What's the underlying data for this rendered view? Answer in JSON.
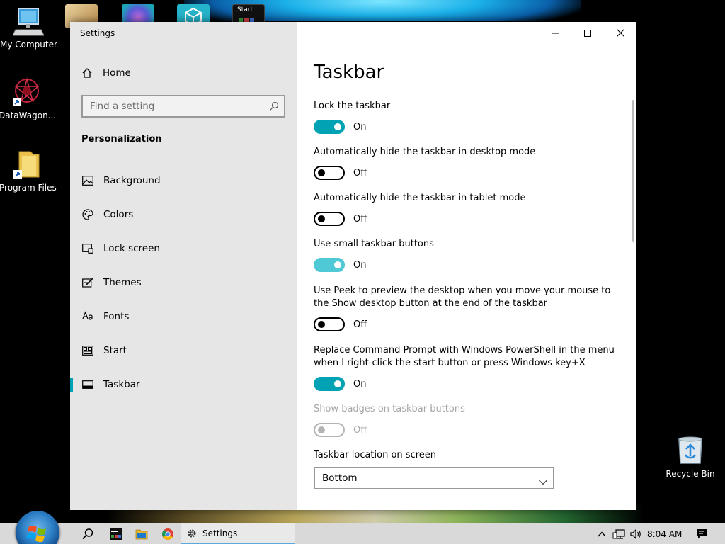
{
  "desktop": {
    "icons": [
      {
        "label": "My Computer"
      },
      {
        "label": "DataWagon..."
      },
      {
        "label": "Program Files"
      },
      {
        "label": "Recycle Bin"
      }
    ],
    "top_tile_label": "Start"
  },
  "window": {
    "title": "Settings",
    "controls": {
      "minimize": "minimize",
      "maximize": "maximize",
      "close": "close"
    }
  },
  "sidebar": {
    "home_label": "Home",
    "search": {
      "placeholder": "Find a setting",
      "value": ""
    },
    "section_title": "Personalization",
    "items": [
      {
        "label": "Background",
        "icon": "image-icon"
      },
      {
        "label": "Colors",
        "icon": "palette-icon"
      },
      {
        "label": "Lock screen",
        "icon": "lock-screen-icon"
      },
      {
        "label": "Themes",
        "icon": "themes-icon"
      },
      {
        "label": "Fonts",
        "icon": "fonts-icon"
      },
      {
        "label": "Start",
        "icon": "start-icon"
      },
      {
        "label": "Taskbar",
        "icon": "taskbar-icon",
        "active": true
      }
    ]
  },
  "main": {
    "title": "Taskbar",
    "settings": [
      {
        "label": "Lock the taskbar",
        "state": "On"
      },
      {
        "label": "Automatically hide the taskbar in desktop mode",
        "state": "Off"
      },
      {
        "label": "Automatically hide the taskbar in tablet mode",
        "state": "Off"
      },
      {
        "label": "Use small taskbar buttons",
        "state": "On"
      },
      {
        "label": "Use Peek to preview the desktop when you move your mouse to the Show desktop button at the end of the taskbar",
        "state": "Off"
      },
      {
        "label": "Replace Command Prompt with Windows PowerShell in the menu when I right-click the start button or press Windows key+X",
        "state": "On"
      },
      {
        "label": "Show badges on taskbar buttons",
        "state": "Off",
        "disabled": true
      }
    ],
    "location": {
      "label": "Taskbar location on screen",
      "value": "Bottom"
    }
  },
  "taskbar": {
    "settings_button_label": "Settings",
    "time": "8:04 AM"
  },
  "colors": {
    "accent": "#00a2b4",
    "accent_light": "#4fc9d6",
    "sidebar_bg": "#e6e6e6",
    "taskbar_bg": "#d9d9d9"
  }
}
